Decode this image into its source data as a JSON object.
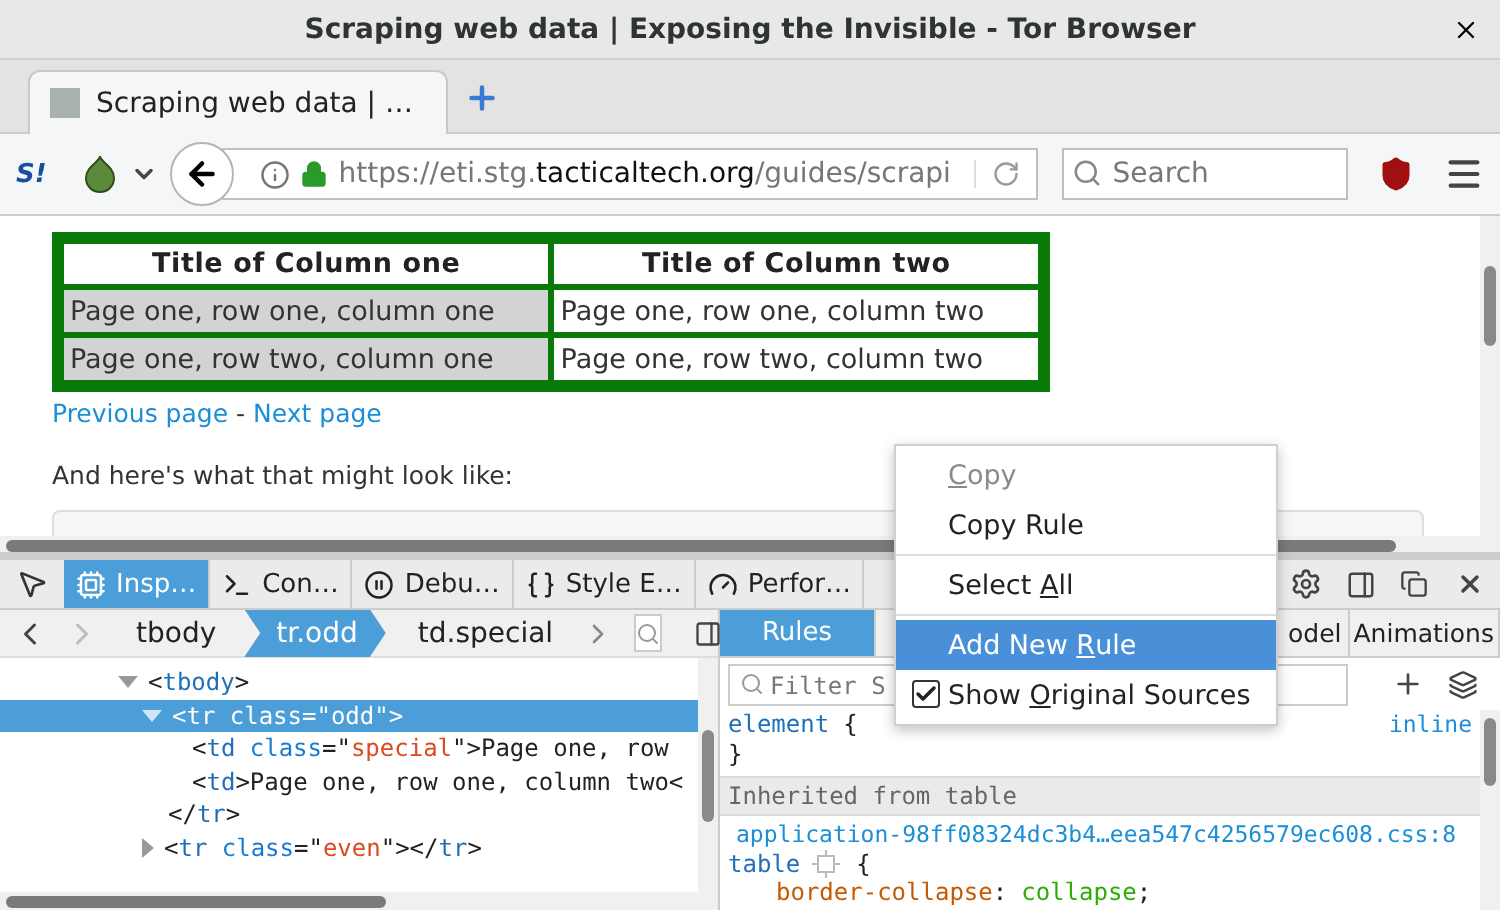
{
  "window": {
    "title": "Scraping web data | Exposing the Invisible - Tor Browser"
  },
  "tabs": [
    {
      "title": "Scraping web data | …",
      "selected": true
    }
  ],
  "toolbar": {
    "extension_badge": "S!",
    "url_prefix": "https://eti.stg.",
    "url_domain": "tacticaltech.org",
    "url_suffix": "/guides/scrapi",
    "search_placeholder": "Search"
  },
  "page": {
    "table": {
      "columns": [
        "Title of Column one",
        "Title of Column two"
      ],
      "rows": [
        {
          "cells": [
            {
              "text": "Page one, row one, column one",
              "highlighted": true
            },
            {
              "text": "Page one, row one, column two",
              "highlighted": false
            }
          ]
        },
        {
          "cells": [
            {
              "text": "Page one, row two, column one",
              "highlighted": true
            },
            {
              "text": "Page one, row two, column two",
              "highlighted": false
            }
          ]
        }
      ]
    },
    "links": [
      "Previous page",
      "Next page"
    ],
    "link_separator": "-",
    "paragraph": "And here's what that might look like:"
  },
  "devtools": {
    "tools": [
      {
        "label": "Insp…",
        "selected": true
      },
      {
        "label": "Con…",
        "selected": false
      },
      {
        "label": "Debu…",
        "selected": false
      },
      {
        "label": "Style E…",
        "selected": false
      },
      {
        "label": "Perfor…",
        "selected": false
      }
    ],
    "breadcrumbs": [
      {
        "label": "tbody",
        "selected": false
      },
      {
        "label": "tr.odd",
        "selected": true
      },
      {
        "label": "td.special",
        "selected": false
      }
    ],
    "markup": [
      {
        "tokens": [
          {
            "kind": "punct",
            "text": "<"
          },
          {
            "kind": "tag",
            "text": "tbody"
          },
          {
            "kind": "punct",
            "text": ">"
          }
        ],
        "expanded": true,
        "selected": false,
        "children": [
          {
            "tokens": [
              {
                "kind": "punct",
                "text": "<"
              },
              {
                "kind": "tag",
                "text": "tr"
              },
              {
                "kind": "attr",
                "text": "class"
              },
              {
                "kind": "punct",
                "text": "=\""
              },
              {
                "kind": "value",
                "text": "odd"
              },
              {
                "kind": "punct",
                "text": "\">"
              }
            ],
            "expanded": true,
            "selected": true,
            "children": [
              {
                "tokens": [
                  {
                    "kind": "punct",
                    "text": "<"
                  },
                  {
                    "kind": "tag",
                    "text": "td"
                  },
                  {
                    "kind": "attr",
                    "text": "class"
                  },
                  {
                    "kind": "punct",
                    "text": "=\""
                  },
                  {
                    "kind": "value",
                    "text": "special"
                  },
                  {
                    "kind": "punct",
                    "text": "\">Page one, row"
                  }
                ],
                "selected": false
              },
              {
                "tokens": [
                  {
                    "kind": "punct",
                    "text": "<"
                  },
                  {
                    "kind": "tag",
                    "text": "td"
                  },
                  {
                    "kind": "punct",
                    "text": ">Page one, row one, column two<"
                  }
                ],
                "selected": false
              }
            ],
            "closing": [
              {
                "kind": "punct",
                "text": "</"
              },
              {
                "kind": "tag",
                "text": "tr"
              },
              {
                "kind": "punct",
                "text": ">"
              }
            ]
          },
          {
            "tokens": [
              {
                "kind": "punct",
                "text": "<"
              },
              {
                "kind": "tag",
                "text": "tr"
              },
              {
                "kind": "attr",
                "text": "class"
              },
              {
                "kind": "punct",
                "text": "=\""
              },
              {
                "kind": "value",
                "text": "even"
              },
              {
                "kind": "punct",
                "text": "\"></"
              },
              {
                "kind": "tag",
                "text": "tr"
              },
              {
                "kind": "punct",
                "text": ">"
              }
            ],
            "expanded": false,
            "selected": false
          }
        ]
      }
    ],
    "sidebar_tabs": [
      {
        "label": "Rules",
        "selected": true
      },
      {
        "label": "odel",
        "selected": false
      },
      {
        "label": "Animations",
        "selected": false
      }
    ],
    "filter_placeholder": "Filter S",
    "rules": {
      "element_selector": "element",
      "open_brace": "{",
      "close_brace": "}",
      "element_source": "inline",
      "inherited_header": "Inherited from table",
      "source_link": "application-98ff08324dc3b4…eea547c4256579ec608.css:8",
      "selector": "table",
      "brace": "{",
      "property": "border-collapse",
      "colon": ":",
      "value": "collapse",
      "semicolon": ";"
    }
  },
  "context_menu": [
    {
      "kind": "item",
      "key": "C",
      "post": "opy",
      "disabled": true,
      "selected": false
    },
    {
      "kind": "item",
      "pre": "Copy Rule",
      "disabled": false,
      "selected": false
    },
    {
      "kind": "separator"
    },
    {
      "kind": "item",
      "pre": "Select ",
      "key": "A",
      "post": "ll",
      "disabled": false,
      "selected": false
    },
    {
      "kind": "separator"
    },
    {
      "kind": "item",
      "pre": "Add New ",
      "key": "R",
      "post": "ule",
      "disabled": false,
      "selected": true
    },
    {
      "kind": "checkbox",
      "pre": "Show ",
      "key": "O",
      "post": "riginal Sources",
      "disabled": false,
      "selected": false,
      "checked": true
    }
  ]
}
